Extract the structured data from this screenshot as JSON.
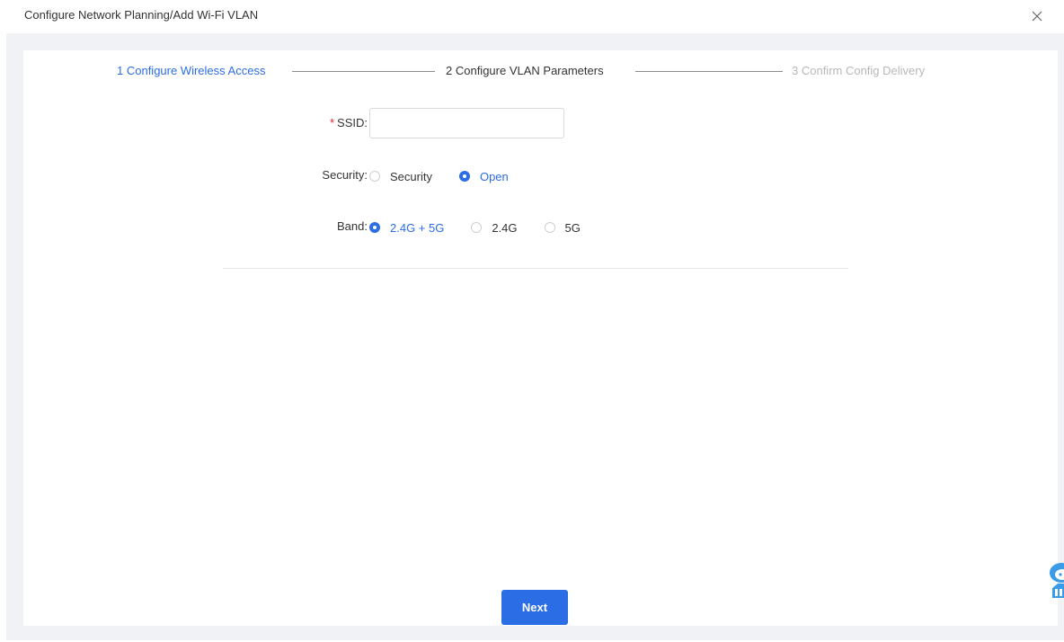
{
  "dialog": {
    "title": "Configure Network Planning/Add Wi-Fi VLAN",
    "close_icon": "close-icon"
  },
  "steps": [
    {
      "label": "1 Configure Wireless Access",
      "state": "done"
    },
    {
      "label": "2 Configure VLAN Parameters",
      "state": "active"
    },
    {
      "label": "3 Confirm Config Delivery",
      "state": "pending"
    }
  ],
  "form": {
    "ssid": {
      "required_mark": "*",
      "label": "SSID:",
      "value": "",
      "placeholder": ""
    },
    "security": {
      "label": "Security:",
      "options": [
        "Security",
        "Open"
      ],
      "selected": "Open"
    },
    "band": {
      "label": "Band:",
      "options": [
        "2.4G + 5G",
        "2.4G",
        "5G"
      ],
      "selected": "2.4G + 5G"
    }
  },
  "actions": {
    "next_label": "Next"
  },
  "colors": {
    "accent": "#2b6de5",
    "required": "#f5222d",
    "pending_step": "#b8b8b8",
    "body_bg": "#f0f2f5"
  },
  "icons": {
    "assistant": "assistant-robot-icon"
  }
}
